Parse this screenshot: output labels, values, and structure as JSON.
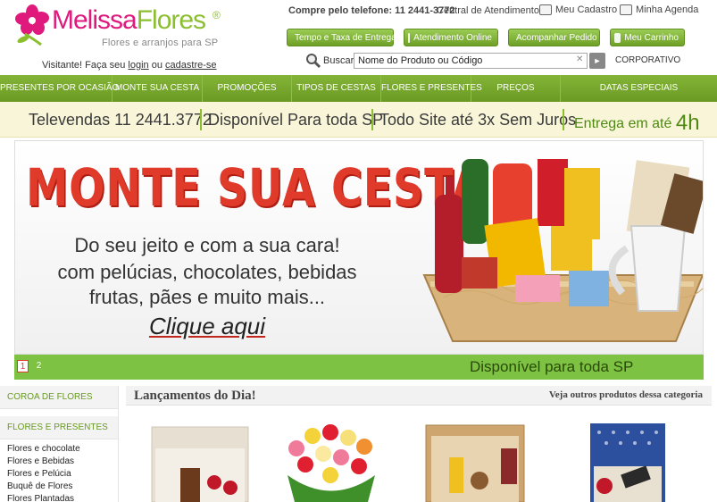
{
  "brand": {
    "name_part1": "Melissa",
    "name_part2": "Flores",
    "reg": "®",
    "tagline": "Flores e arranjos para SP"
  },
  "top": {
    "phone_label": "Compre pelo telefone: 11 2441-3772",
    "central": "Central de Atendimento",
    "meu_cadastro": "Meu Cadastro",
    "minha_agenda": "Minha Agenda"
  },
  "buttons": {
    "tempo": "Tempo e Taxa de Entrega",
    "atendimento": "Atendimento Online",
    "acompanhar": "Acompanhar Pedido",
    "carrinho": "Meu Carrinho"
  },
  "login": {
    "prefix": "Visitante! Faça seu",
    "login": "login",
    "mid": "ou",
    "cadastre": "cadastre-se"
  },
  "search": {
    "label": "Buscar",
    "value": "Nome do Produto ou Código",
    "clear": "✕",
    "go": "►",
    "corporativo": "CORPORATIVO"
  },
  "nav": [
    "PRESENTES POR OCASIÃO",
    "MONTE SUA CESTA",
    "PROMOÇÕES",
    "TIPOS DE CESTAS",
    "FLORES E PRESENTES",
    "PREÇOS",
    "DATAS ESPECIAIS"
  ],
  "info": {
    "televendas": "Televendas 11 2441.3772",
    "disponivel": "Disponível Para toda SP",
    "juros": "Todo Site até 3x Sem Juros",
    "entrega": "Entrega em até",
    "entrega_h": "4h"
  },
  "banner": {
    "title": "MONTE SUA CESTA",
    "line1": "Do seu  jeito e com a sua cara!",
    "line2": "com pelúcias, chocolates, bebidas",
    "line3": "frutas, pães e muito mais...",
    "cta": "Clique aqui",
    "page1": "1",
    "page2": "2",
    "green_text": "Disponível para toda SP"
  },
  "sidebar": {
    "coroa": "COROA DE FLORES",
    "flores_head": "FLORES E PRESENTES",
    "items": [
      "Flores e chocolate",
      "Flores e Bebidas",
      "Flores e Pelúcia",
      "Buquê de Flores",
      "Flores Plantadas"
    ]
  },
  "products": {
    "title": "Lançamentos do Dia!",
    "more": "Veja outros produtos dessa categoria"
  },
  "colors": {
    "pink": "#e0197d",
    "green": "#8cbf2f",
    "nav": "#6a9a23",
    "red": "#e03a2a"
  }
}
